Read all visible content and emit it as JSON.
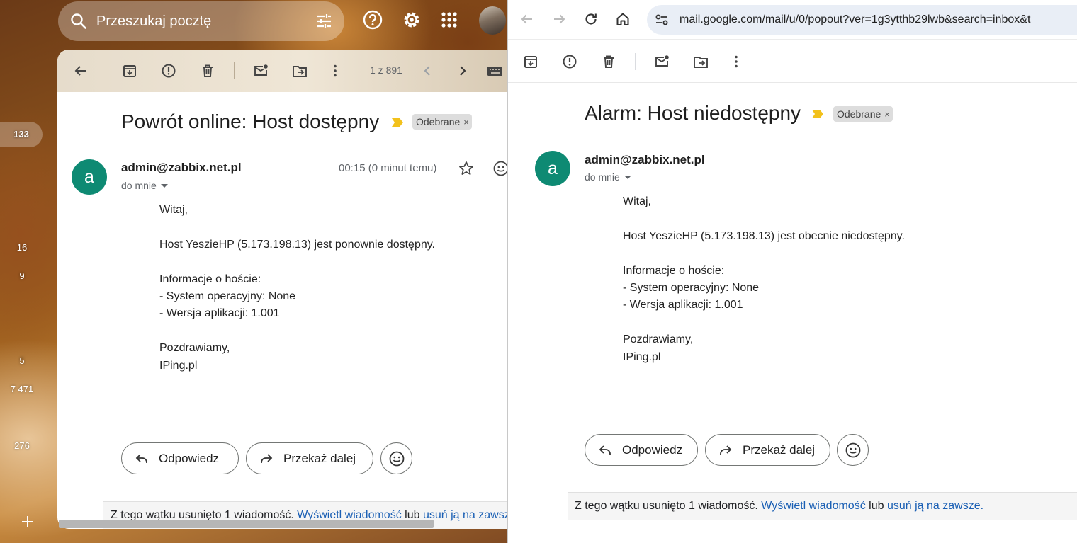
{
  "left_window": {
    "search_placeholder": "Przeszukaj pocztę",
    "rail_counts": [
      "133",
      "16",
      "9",
      "5",
      "7 471",
      "276"
    ],
    "pager": "1 z 891",
    "message": {
      "subject": "Powrót online: Host dostępny",
      "label": "Odebrane",
      "label_close": "×",
      "avatar_letter": "a",
      "sender": "admin@zabbix.net.pl",
      "recipient": "do mnie",
      "timestamp": "00:15 (0 minut temu)",
      "body": "Witaj,\n\nHost YeszieHP (5.173.198.13) jest ponownie dostępny.\n\nInformacje o hoście:\n- System operacyjny: None\n- Wersja aplikacji: 1.001\n\nPozdrawiamy,\nIPing.pl"
    },
    "reply_label": "Odpowiedz",
    "forward_label": "Przekaż dalej",
    "deleted_note": {
      "text": "Z tego wątku usunięto 1 wiadomość. ",
      "view_link": "Wyświetl wiadomość",
      "or": " lub ",
      "delete_link": "usuń ją na zawsze."
    }
  },
  "right_window": {
    "url": "mail.google.com/mail/u/0/popout?ver=1g3ytthb29lwb&search=inbox&t",
    "message": {
      "subject": "Alarm: Host niedostępny",
      "label": "Odebrane",
      "label_close": "×",
      "avatar_letter": "a",
      "sender": "admin@zabbix.net.pl",
      "recipient": "do mnie",
      "body": "Witaj,\n\nHost YeszieHP (5.173.198.13) jest obecnie niedostępny.\n\nInformacje o hoście:\n- System operacyjny: None\n- Wersja aplikacji: 1.001\n\nPozdrawiamy,\nIPing.pl"
    },
    "reply_label": "Odpowiedz",
    "forward_label": "Przekaż dalej",
    "deleted_note": {
      "text": "Z tego wątku usunięto 1 wiadomość. ",
      "view_link": "Wyświetl wiadomość",
      "or": " lub ",
      "delete_link": "usuń ją na zawsze."
    }
  },
  "colors": {
    "avatar": "#0e8a73",
    "label_chip": "#dddddd",
    "link": "#1a5fb4",
    "important_marker": "#f2c11b"
  }
}
